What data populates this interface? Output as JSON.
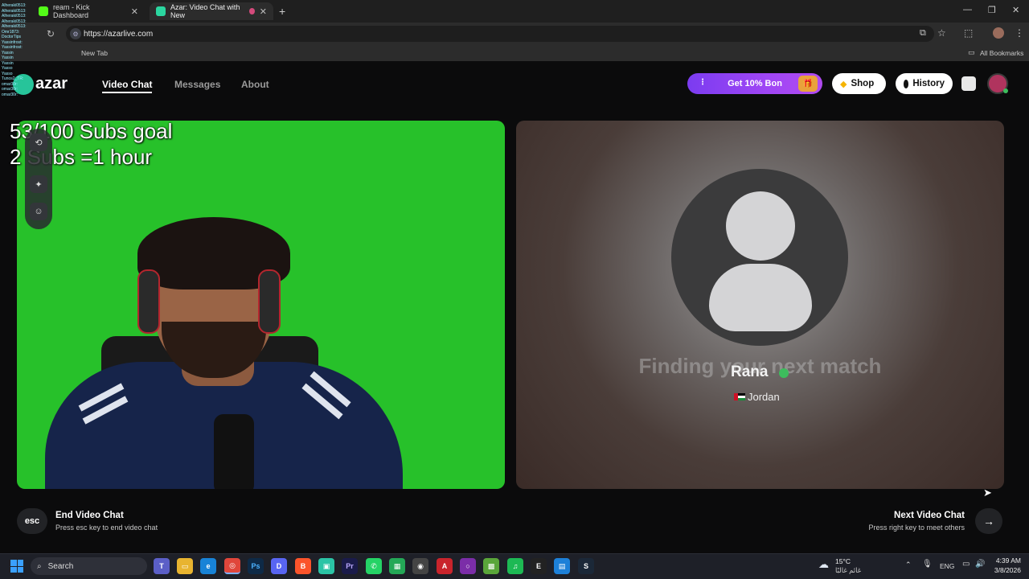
{
  "browser": {
    "tabs": [
      {
        "label": "ream - Kick Dashboard",
        "active": false
      },
      {
        "label": "Azar: Video Chat with New",
        "active": true
      }
    ],
    "url": "https://azarlive.com",
    "bookmark_new_tab": "New Tab",
    "all_bookmarks": "All Bookmarks"
  },
  "stream_overlay": {
    "chat_lines": [
      "Alheraki0513:",
      "Alheraki0513:",
      "Alheraki0513:",
      "Alheraki0513:",
      "Alheraki0513:",
      "Omr1873:",
      "DoctorTips",
      "Yassinfrost:",
      "Yassinfrost:",
      "Yassin",
      "Yassin",
      "Yassin",
      "Yasso",
      "Yasso",
      "Tunos2_TR:",
      "omar30r:",
      "omar30r:",
      "omar30r:"
    ],
    "goal_line1": "53/100 Subs goal",
    "goal_line2": "2 Subs =1 hour"
  },
  "app": {
    "logo": "azar",
    "nav": {
      "video_chat": "Video Chat",
      "messages": "Messages",
      "about": "About"
    },
    "promo_label": "Get 10% Bon",
    "shop_label": "Shop",
    "history_label": "History"
  },
  "match": {
    "finding_text": "Finding your next match",
    "name": "Rana",
    "country": "Jordan"
  },
  "footer": {
    "esc_key": "esc",
    "end_title": "End Video Chat",
    "end_sub": "Press esc key to end video chat",
    "next_title": "Next Video Chat",
    "next_sub": "Press right key to meet others"
  },
  "taskbar": {
    "search_label": "Search",
    "weather_temp": "15°C",
    "weather_desc": "غائم غالبًا",
    "lang": "ENG",
    "time": "4:39 AM",
    "date": "3/8/2026"
  },
  "colors": {
    "green_screen": "#27c12a",
    "promo": "#9b45f3",
    "online": "#3dbd5d"
  }
}
